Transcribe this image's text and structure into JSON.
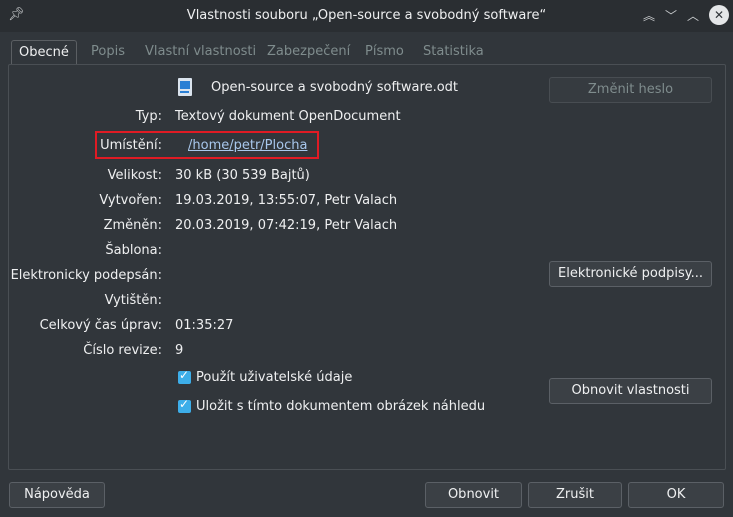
{
  "window": {
    "title": "Vlastnosti souboru „Open-source a svobodný software“"
  },
  "tabs": [
    "Obecné",
    "Popis",
    "Vlastní vlastnosti",
    "Zabezpečení",
    "Písmo",
    "Statistika"
  ],
  "general": {
    "filename": "Open-source a svobodný software.odt",
    "type_label": "Typ:",
    "type_value": "Textový dokument OpenDocument",
    "location_label": "Umístění:",
    "location_value": "/home/petr/Plocha",
    "size_label": "Velikost:",
    "size_value": "30 kB (30 539 Bajtů)",
    "created_label": "Vytvořen:",
    "created_value": "19.03.2019, 13:55:07, Petr Valach",
    "modified_label": "Změněn:",
    "modified_value": "20.03.2019, 07:42:19, Petr Valach",
    "template_label": "Šablona:",
    "signed_label": "Elektronicky podepsán:",
    "printed_label": "Vytištěn:",
    "edit_time_label": "Celkový čas úprav:",
    "edit_time_value": "01:35:27",
    "revision_label": "Číslo revize:",
    "revision_value": "9",
    "use_user_data_label": "Použít uživatelské údaje",
    "save_thumbnail_label": "Uložit s tímto dokumentem obrázek náhledu"
  },
  "buttons": {
    "change_password": "Změnit heslo",
    "digital_signatures": "Elektronické podpisy...",
    "reset_properties": "Obnovit vlastnosti",
    "help": "Nápověda",
    "reset": "Obnovit",
    "cancel": "Zrušit",
    "ok": "OK"
  },
  "colors": {
    "accent": "#3daee9",
    "highlight_box": "#e01b24",
    "link": "#a8c7ec"
  }
}
